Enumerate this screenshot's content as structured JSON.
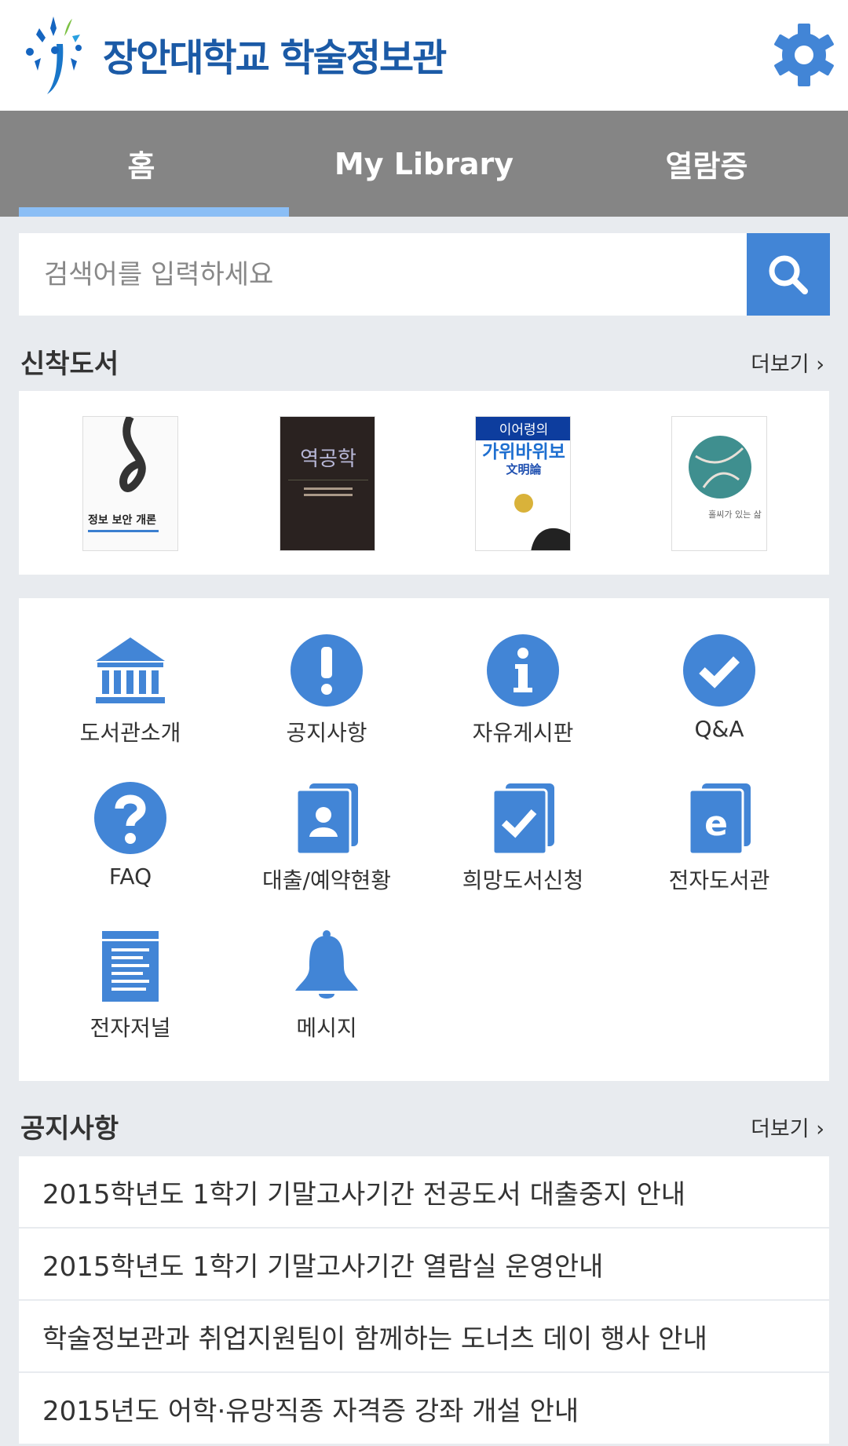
{
  "header": {
    "logo_text": "장안대학교 학술정보관",
    "settings_icon": "gear-icon"
  },
  "tabs": [
    {
      "label": "홈",
      "active": true
    },
    {
      "label": "My Library",
      "active": false
    },
    {
      "label": "열람증",
      "active": false
    }
  ],
  "search": {
    "placeholder": "검색어를 입력하세요",
    "value": ""
  },
  "new_books": {
    "title": "신착도서",
    "more": "더보기 ›",
    "books": [
      {
        "cover_title": "정보 보안 개론"
      },
      {
        "cover_title": "역공학"
      },
      {
        "cover_top": "이어령의",
        "cover_title": "가위바위보",
        "cover_sub": "文明論"
      },
      {
        "cover_title": "홀씨가 있는 삶"
      }
    ]
  },
  "menu": [
    {
      "label": "도서관소개",
      "icon": "library-icon"
    },
    {
      "label": "공지사항",
      "icon": "exclamation-icon"
    },
    {
      "label": "자유게시판",
      "icon": "info-icon"
    },
    {
      "label": "Q&A",
      "icon": "check-circle-icon"
    },
    {
      "label": "FAQ",
      "icon": "question-icon"
    },
    {
      "label": "대출/예약현황",
      "icon": "contact-book-icon"
    },
    {
      "label": "희망도서신청",
      "icon": "check-book-icon"
    },
    {
      "label": "전자도서관",
      "icon": "ebook-icon"
    },
    {
      "label": "전자저널",
      "icon": "notepad-icon"
    },
    {
      "label": "메시지",
      "icon": "bell-icon"
    }
  ],
  "notices": {
    "title": "공지사항",
    "more": "더보기 ›",
    "items": [
      "2015학년도 1학기 기말고사기간 전공도서 대출중지 안내",
      "2015학년도 1학기 기말고사기간 열람실 운영안내",
      "학술정보관과 취업지원팀이 함께하는 도너츠 데이 행사 안내",
      "2015년도 어학·유망직종 자격증 강좌 개설 안내"
    ]
  },
  "colors": {
    "accent": "#4285d6",
    "tab_bar": "#858585",
    "tab_indicator": "#8bbef5",
    "background": "#e8ebef",
    "logo": "#1b5aa6"
  }
}
